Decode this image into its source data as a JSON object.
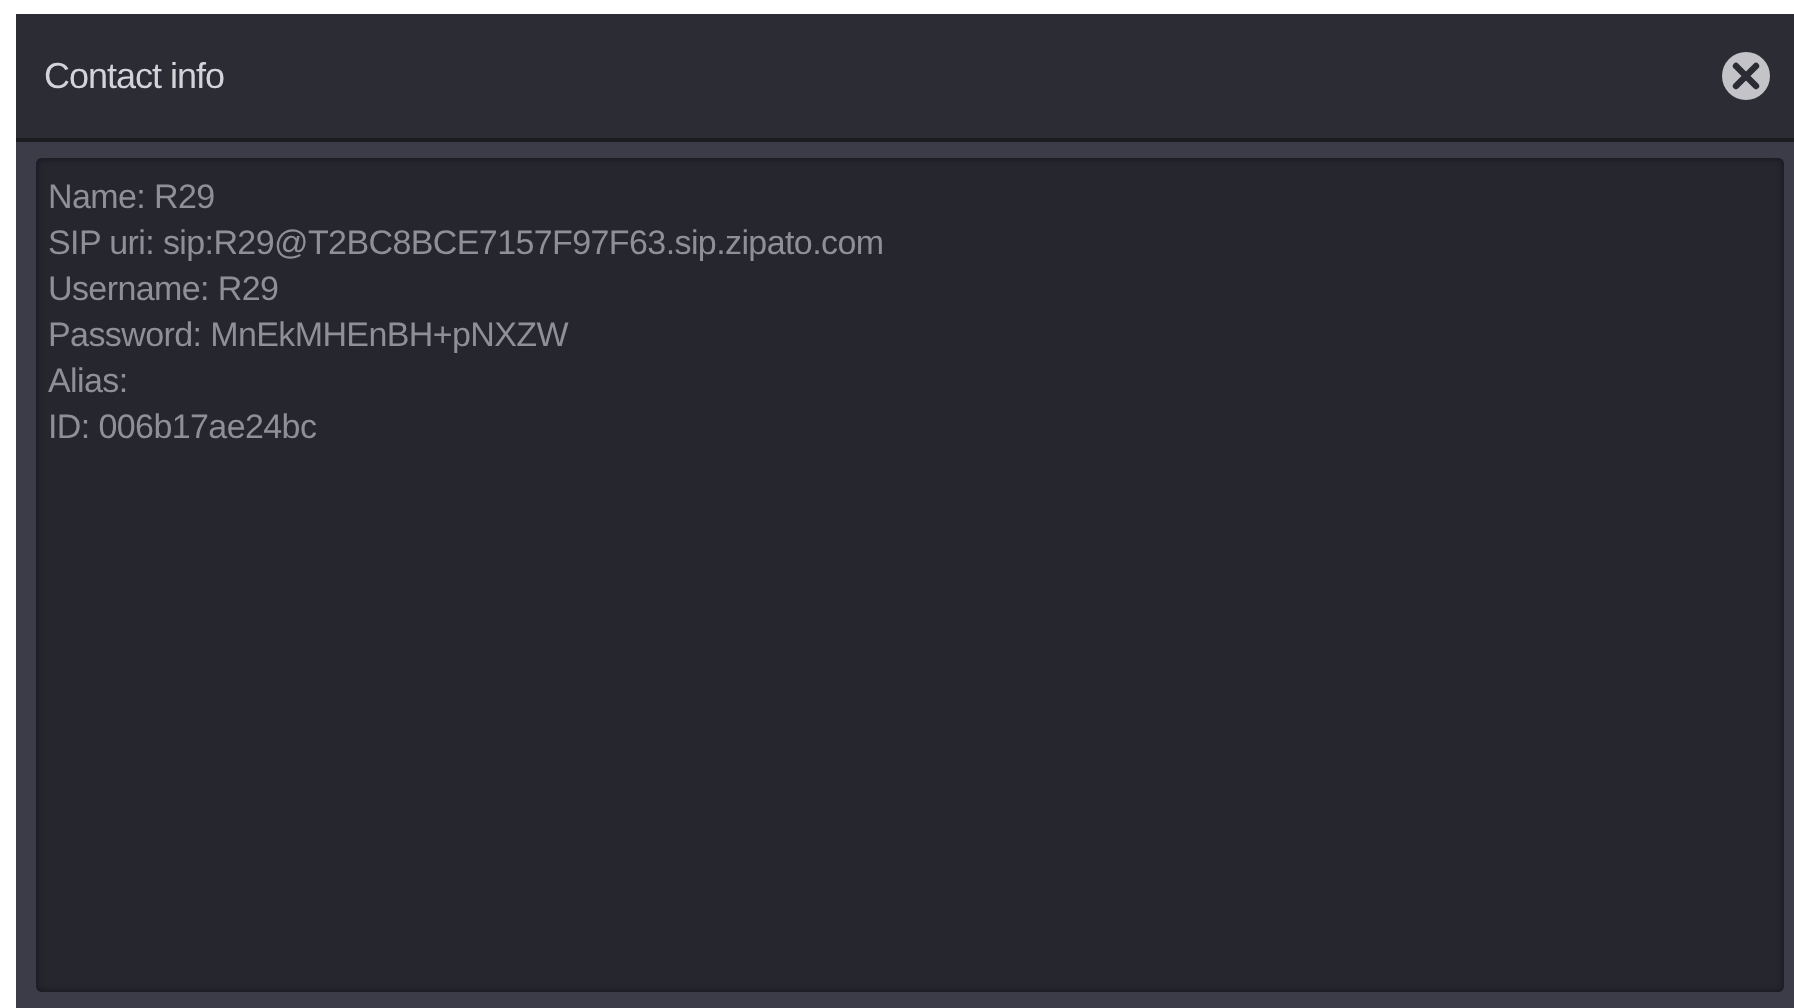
{
  "dialog": {
    "title": "Contact info",
    "lines": [
      "Name: R29",
      "SIP uri: sip:R29@T2BC8BCE7157F97F63.sip.zipato.com",
      "Username: R29",
      "Password: MnEkMHEnBH+pNXZW",
      "Alias:",
      "ID: 006b17ae24bc"
    ]
  }
}
